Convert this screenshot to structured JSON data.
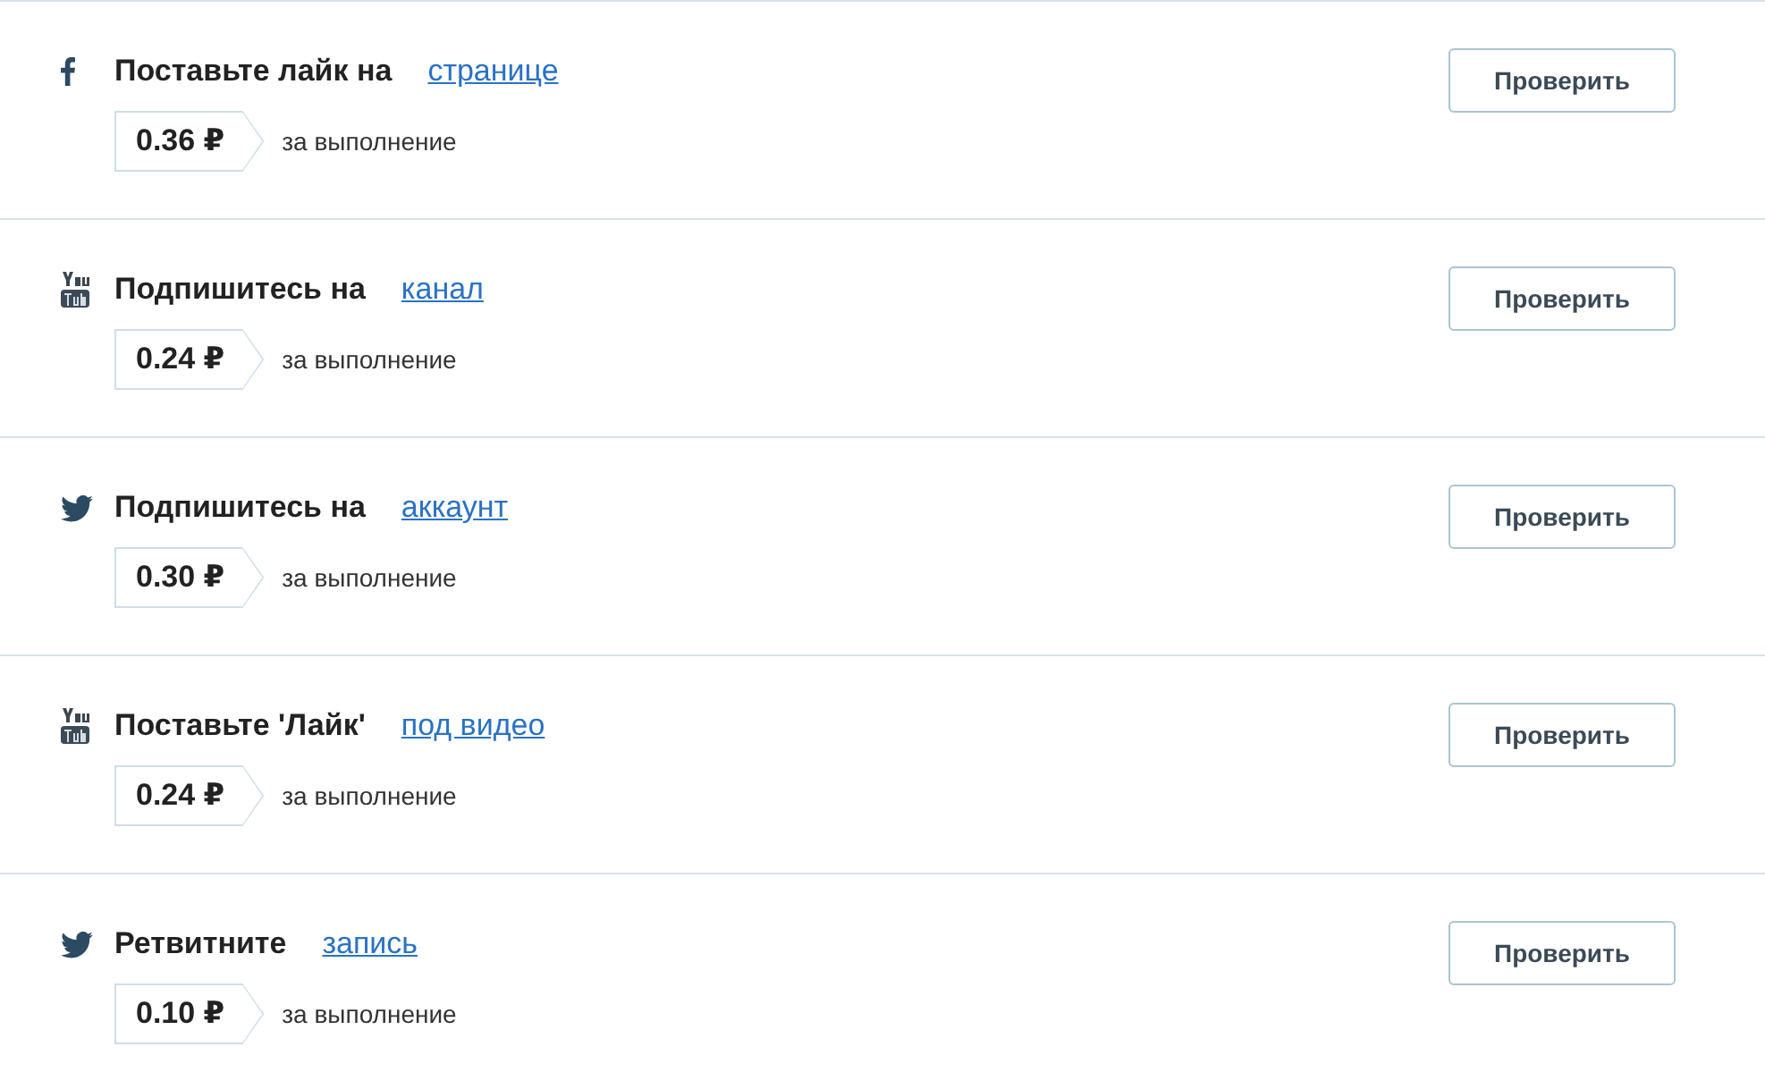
{
  "tasks": [
    {
      "kind": "facebook",
      "title": "Поставьте лайк на",
      "link": "странице",
      "price": "0.36 ₽",
      "note": "за выполнение",
      "button": "Проверить"
    },
    {
      "kind": "youtube",
      "title": "Подпишитесь на",
      "link": "канал",
      "price": "0.24 ₽",
      "note": "за выполнение",
      "button": "Проверить"
    },
    {
      "kind": "twitter",
      "title": "Подпишитесь на",
      "link": "аккаунт",
      "price": "0.30 ₽",
      "note": "за выполнение",
      "button": "Проверить"
    },
    {
      "kind": "youtube",
      "title": "Поставьте 'Лайк'",
      "link": "под видео",
      "price": "0.24 ₽",
      "note": "за выполнение",
      "button": "Проверить"
    },
    {
      "kind": "twitter",
      "title": "Ретвитните",
      "link": "запись",
      "price": "0.10 ₽",
      "note": "за выполнение",
      "button": "Проверить"
    }
  ]
}
